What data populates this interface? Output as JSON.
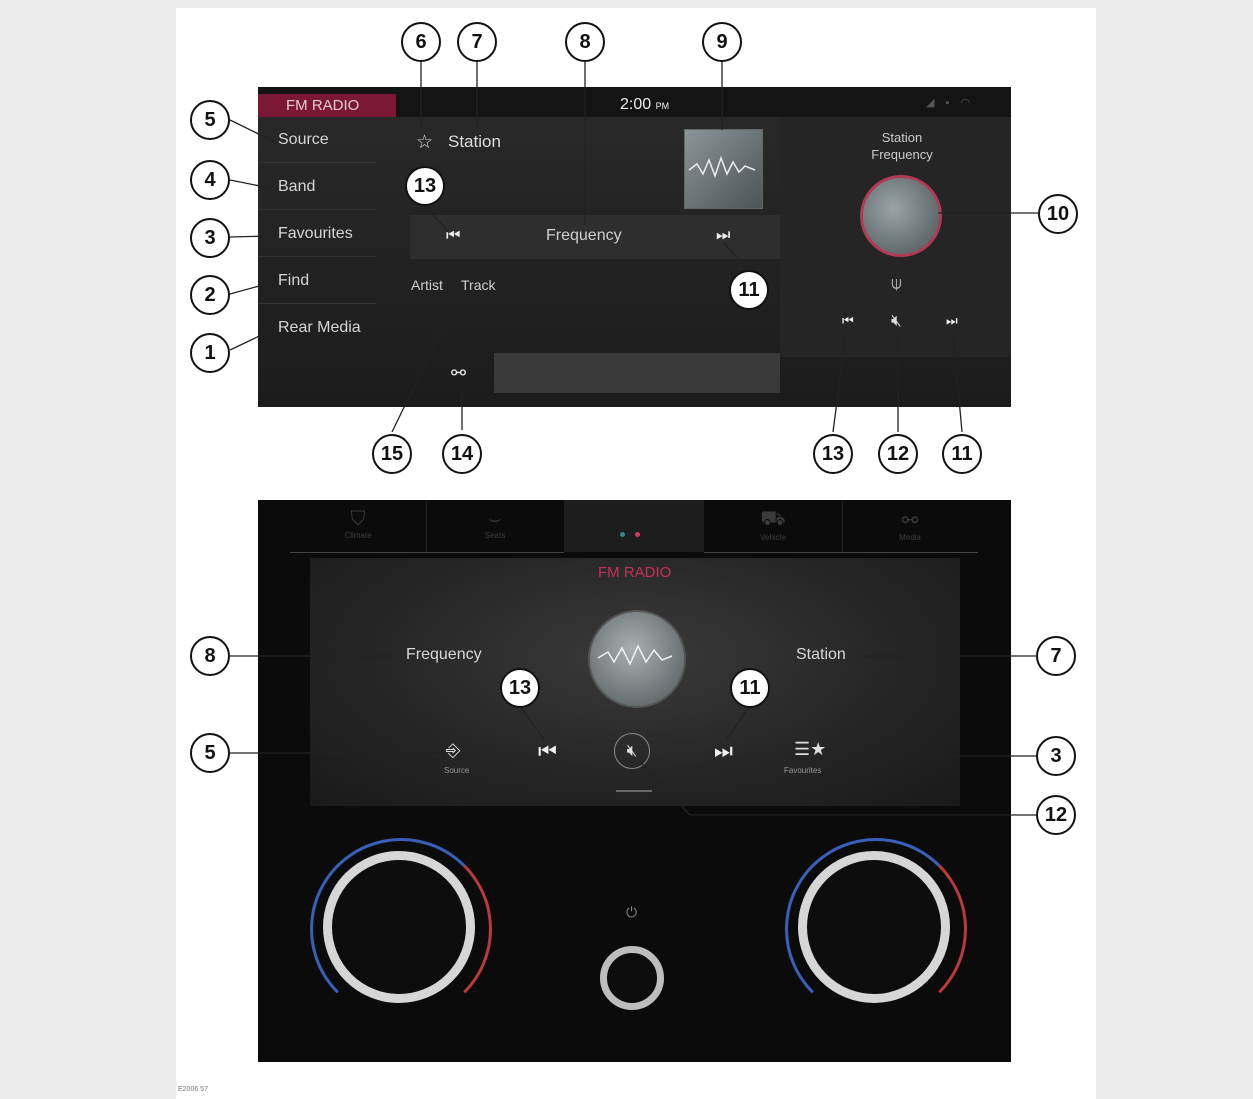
{
  "figure_id": "E2006 57",
  "top_screen": {
    "header_tab": "FM RADIO",
    "time": "2:00",
    "time_suffix": "PM",
    "sidebar": [
      "Source",
      "Band",
      "Favourites",
      "Find",
      "Rear Media"
    ],
    "station": "Station",
    "frequency": "Frequency",
    "artist": "Artist",
    "track": "Track",
    "right_panel_label": "Station Frequency",
    "icons": {
      "favourite": "star-icon",
      "previous": "skip-previous-icon",
      "next": "skip-next-icon",
      "mute": "mute-icon",
      "antenna": "antenna-icon",
      "link": "link-icon"
    }
  },
  "bottom_screen": {
    "tabs": [
      "Climate",
      "Seats",
      "Vehicle",
      "Media"
    ],
    "active_title": "FM RADIO",
    "frequency": "Frequency",
    "station": "Station",
    "source_label": "Source",
    "favourites_label": "Favourites"
  },
  "callouts": {
    "c1": "1",
    "c2": "2",
    "c3": "3",
    "c4": "4",
    "c5": "5",
    "c6": "6",
    "c7": "7",
    "c8": "8",
    "c9": "9",
    "c10": "10",
    "c11": "11",
    "c12": "12",
    "c13": "13",
    "c14": "14",
    "c15": "15"
  },
  "colors": {
    "accent": "#7a1836",
    "accent_text": "#c62f5c",
    "screen_bg": "#1c1c1c"
  }
}
